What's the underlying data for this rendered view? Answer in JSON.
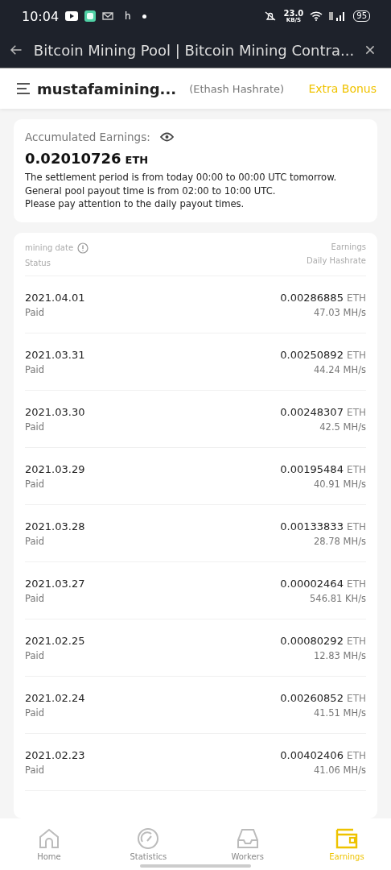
{
  "status_bar": {
    "time": "10:04",
    "notification_letter": "h",
    "net_speed": "23.0",
    "net_unit": "KB/S",
    "battery": "95"
  },
  "title_bar": {
    "title": "Bitcoin Mining Pool | Bitcoin Mining Contra..."
  },
  "header": {
    "account": "mustafamining...",
    "algorithm": "(Ethash Hashrate)",
    "bonus_link": "Extra Bonus"
  },
  "summary": {
    "label": "Accumulated Earnings:",
    "amount": "0.02010726",
    "unit": "ETH",
    "notes": [
      "The settlement period is from today 00:00 to 00:00 UTC tomorrow.",
      "General pool payout time is from 02:00 to 10:00 UTC.",
      "Please pay attention to the daily payout times."
    ]
  },
  "table": {
    "columns": {
      "date": "mining date",
      "status": "Status",
      "earnings": "Earnings",
      "hashrate": "Daily Hashrate"
    },
    "rows": [
      {
        "date": "2021.04.01",
        "status": "Paid",
        "earnings": "0.00286885",
        "unit": "ETH",
        "hashrate": "47.03 MH/s"
      },
      {
        "date": "2021.03.31",
        "status": "Paid",
        "earnings": "0.00250892",
        "unit": "ETH",
        "hashrate": "44.24 MH/s"
      },
      {
        "date": "2021.03.30",
        "status": "Paid",
        "earnings": "0.00248307",
        "unit": "ETH",
        "hashrate": "42.5 MH/s"
      },
      {
        "date": "2021.03.29",
        "status": "Paid",
        "earnings": "0.00195484",
        "unit": "ETH",
        "hashrate": "40.91 MH/s"
      },
      {
        "date": "2021.03.28",
        "status": "Paid",
        "earnings": "0.00133833",
        "unit": "ETH",
        "hashrate": "28.78 MH/s"
      },
      {
        "date": "2021.03.27",
        "status": "Paid",
        "earnings": "0.00002464",
        "unit": "ETH",
        "hashrate": "546.81 KH/s"
      },
      {
        "date": "2021.02.25",
        "status": "Paid",
        "earnings": "0.00080292",
        "unit": "ETH",
        "hashrate": "12.83 MH/s"
      },
      {
        "date": "2021.02.24",
        "status": "Paid",
        "earnings": "0.00260852",
        "unit": "ETH",
        "hashrate": "41.51 MH/s"
      },
      {
        "date": "2021.02.23",
        "status": "Paid",
        "earnings": "0.00402406",
        "unit": "ETH",
        "hashrate": "41.06 MH/s"
      }
    ]
  },
  "bottom_nav": [
    {
      "label": "Home",
      "kind": "home",
      "selected": false
    },
    {
      "label": "Statistics",
      "kind": "gauge",
      "selected": false
    },
    {
      "label": "Workers",
      "kind": "tray",
      "selected": false
    },
    {
      "label": "Earnings",
      "kind": "wallet",
      "selected": true
    }
  ]
}
